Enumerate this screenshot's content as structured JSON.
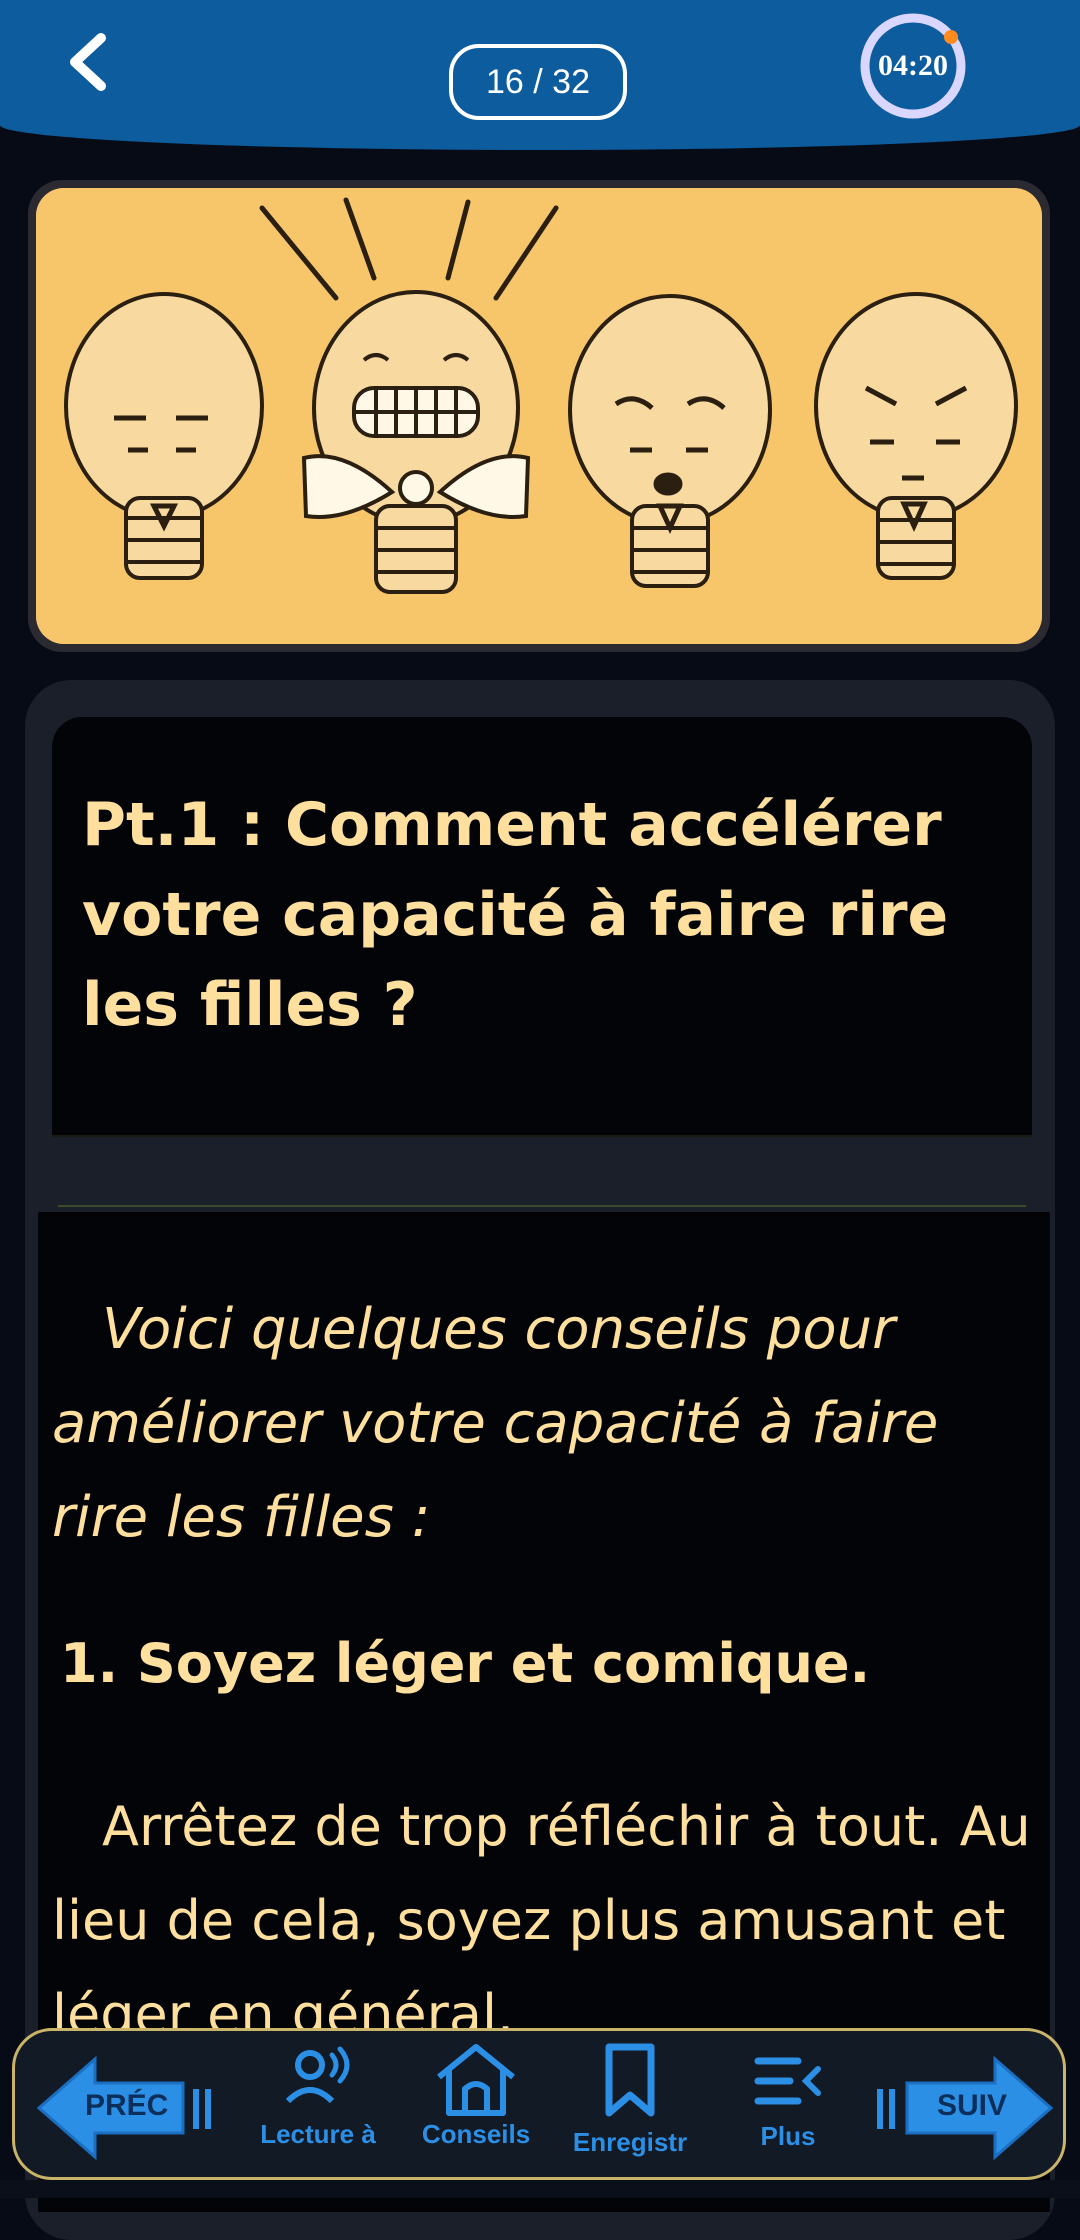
{
  "header": {
    "page_counter": "16 / 32",
    "timer": "04:20",
    "timer_progress": 0.97
  },
  "content": {
    "title": "Pt.1 : Comment accélérer votre capacité à faire rire les filles ?",
    "intro": "Voici quelques conseils pour améliorer votre capacité à faire rire les filles :",
    "heading": "1. Soyez léger et comique.",
    "paragraph": "Arrêtez de trop réfléchir à tout. Au lieu de cela, soyez plus amusant et léger en général."
  },
  "bottom_nav": {
    "prev_label": "PRÉC",
    "next_label": "SUIV",
    "items": [
      {
        "label": "Lecture à",
        "icon": "person-voice-icon"
      },
      {
        "label": "Conseils",
        "icon": "home-icon"
      },
      {
        "label": "Enregistr",
        "icon": "bookmark-icon"
      },
      {
        "label": "Plus",
        "icon": "menu-more-icon"
      }
    ]
  },
  "colors": {
    "header": "#0d5c9e",
    "text": "#ffdf9e",
    "nav_accent": "#2c8fe6",
    "illustration_bg": "#f7c56a"
  }
}
